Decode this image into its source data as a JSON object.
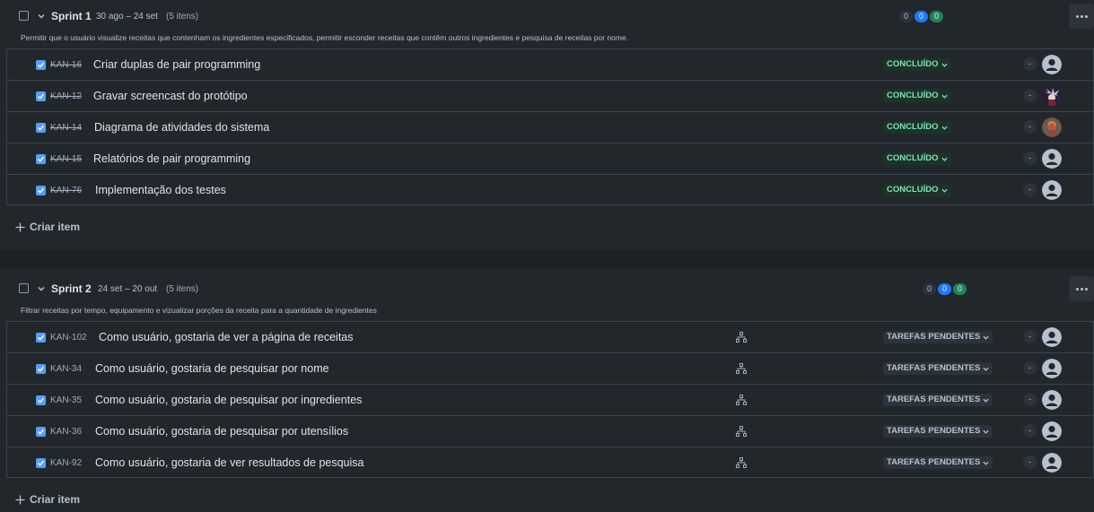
{
  "colors": {
    "page_bg": "#1d2125",
    "panel_bg": "#22272b",
    "done_badge": "#7ee2b8",
    "blue_pill": "#1d7afc",
    "green_pill": "#1f845a"
  },
  "sprints": [
    {
      "name": "Sprint 1",
      "dates": "30 ago – 24 set",
      "count": "(5 itens)",
      "pills": [
        "0",
        "0",
        "0"
      ],
      "goal": "Permitir que o usuário visualize receitas que contenham os ingredientes especificados, permitir esconder receitas que contêm outros ingredientes e pesquisa de receitas por nome.",
      "create_label": "Criar item",
      "items": [
        {
          "key": "KAN-16",
          "title": "Criar duplas de pair programming",
          "status": "CONCLUÍDO",
          "estimate": "-",
          "avatar": "default-avatar-icon"
        },
        {
          "key": "KAN-12",
          "title": "Gravar screencast do protótipo",
          "status": "CONCLUÍDO",
          "estimate": "-",
          "avatar": "user-photo-avatar"
        },
        {
          "key": "KAN-14",
          "title": "Diagrama de atividades do sistema",
          "status": "CONCLUÍDO",
          "estimate": "-",
          "avatar": "user-photo-avatar"
        },
        {
          "key": "KAN-15",
          "title": "Relatórios de pair programming",
          "status": "CONCLUÍDO",
          "estimate": "-",
          "avatar": "default-avatar-icon"
        },
        {
          "key": "KAN-76",
          "title": "Implementação dos testes",
          "status": "CONCLUÍDO",
          "estimate": "-",
          "avatar": "default-avatar-icon"
        }
      ]
    },
    {
      "name": "Sprint 2",
      "dates": "24 set – 20 out",
      "count": "(5 itens)",
      "pills": [
        "0",
        "0",
        "0"
      ],
      "goal": "Filtrar receitas por tempo, equipamento e vizualizar porções da receita para a quantidade de ingredientes",
      "create_label": "Criar item",
      "items": [
        {
          "key": "KAN-102",
          "title": "Como usuário, gostaria de ver a página de receitas",
          "status": "TAREFAS PENDENTES",
          "estimate": "-",
          "avatar": "default-avatar-icon"
        },
        {
          "key": "KAN-34",
          "title": "Como usuário, gostaria de pesquisar por nome",
          "status": "TAREFAS PENDENTES",
          "estimate": "-",
          "avatar": "default-avatar-icon"
        },
        {
          "key": "KAN-35",
          "title": "Como usuário, gostaria de pesquisar por ingredientes",
          "status": "TAREFAS PENDENTES",
          "estimate": "-",
          "avatar": "default-avatar-icon"
        },
        {
          "key": "KAN-36",
          "title": "Como usuário, gostaria de pesquisar por utensílios",
          "status": "TAREFAS PENDENTES",
          "estimate": "-",
          "avatar": "default-avatar-icon"
        },
        {
          "key": "KAN-92",
          "title": "Como usuário, gostaria de ver resultados de pesquisa",
          "status": "TAREFAS PENDENTES",
          "estimate": "-",
          "avatar": "default-avatar-icon"
        }
      ]
    }
  ]
}
